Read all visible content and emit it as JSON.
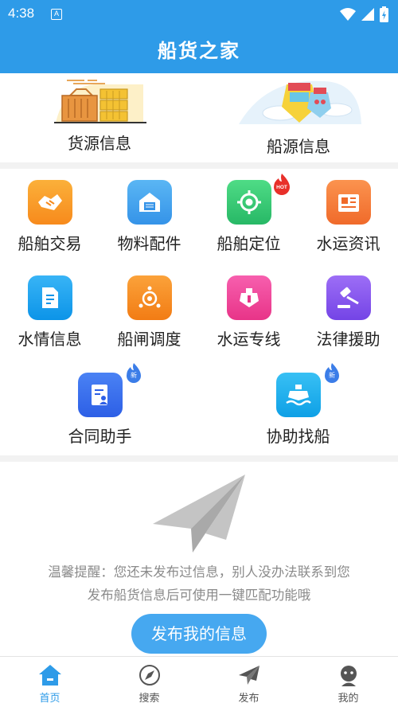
{
  "status_bar": {
    "time": "4:38",
    "a_icon": "A"
  },
  "header": {
    "title": "船货之家"
  },
  "top_cards": [
    {
      "label": "货源信息",
      "icon": "cargo-containers-icon"
    },
    {
      "label": "船源信息",
      "icon": "ship-clouds-icon"
    }
  ],
  "grid": [
    {
      "label": "船舶交易",
      "icon": "handshake-icon",
      "color": "#f89a2b"
    },
    {
      "label": "物料配件",
      "icon": "warehouse-icon",
      "color": "#4aa6ee"
    },
    {
      "label": "船舶定位",
      "icon": "locate-icon",
      "color": "#35c870",
      "badge": "HOT"
    },
    {
      "label": "水运资讯",
      "icon": "news-icon",
      "color": "#f77b3a"
    },
    {
      "label": "水情信息",
      "icon": "document-icon",
      "color": "#1aa3f0"
    },
    {
      "label": "船闸调度",
      "icon": "dispatch-icon",
      "color": "#f88f22"
    },
    {
      "label": "水运专线",
      "icon": "ship-route-icon",
      "color": "#f2459a"
    },
    {
      "label": "法律援助",
      "icon": "gavel-icon",
      "color": "#8c5cf0"
    },
    {
      "label": "合同助手",
      "icon": "contract-icon",
      "color": "#3b6ff0",
      "badge": "新"
    },
    {
      "label": "协助找船",
      "icon": "ship-icon",
      "color": "#1aaee8",
      "badge": "新"
    }
  ],
  "notice": {
    "line1": "温馨提醒：您还未发布过信息，别人没办法联系到您",
    "line2": "发布船货信息后可使用一键匹配功能哦",
    "button": "发布我的信息"
  },
  "nav": [
    {
      "label": "首页",
      "icon": "home-icon",
      "active": true
    },
    {
      "label": "搜索",
      "icon": "compass-icon"
    },
    {
      "label": "发布",
      "icon": "send-icon"
    },
    {
      "label": "我的",
      "icon": "profile-icon"
    }
  ],
  "colors": {
    "primary": "#2e9be8",
    "button": "#46a8f0",
    "hot_badge": "#e8302a",
    "new_badge": "#3b7de8"
  }
}
